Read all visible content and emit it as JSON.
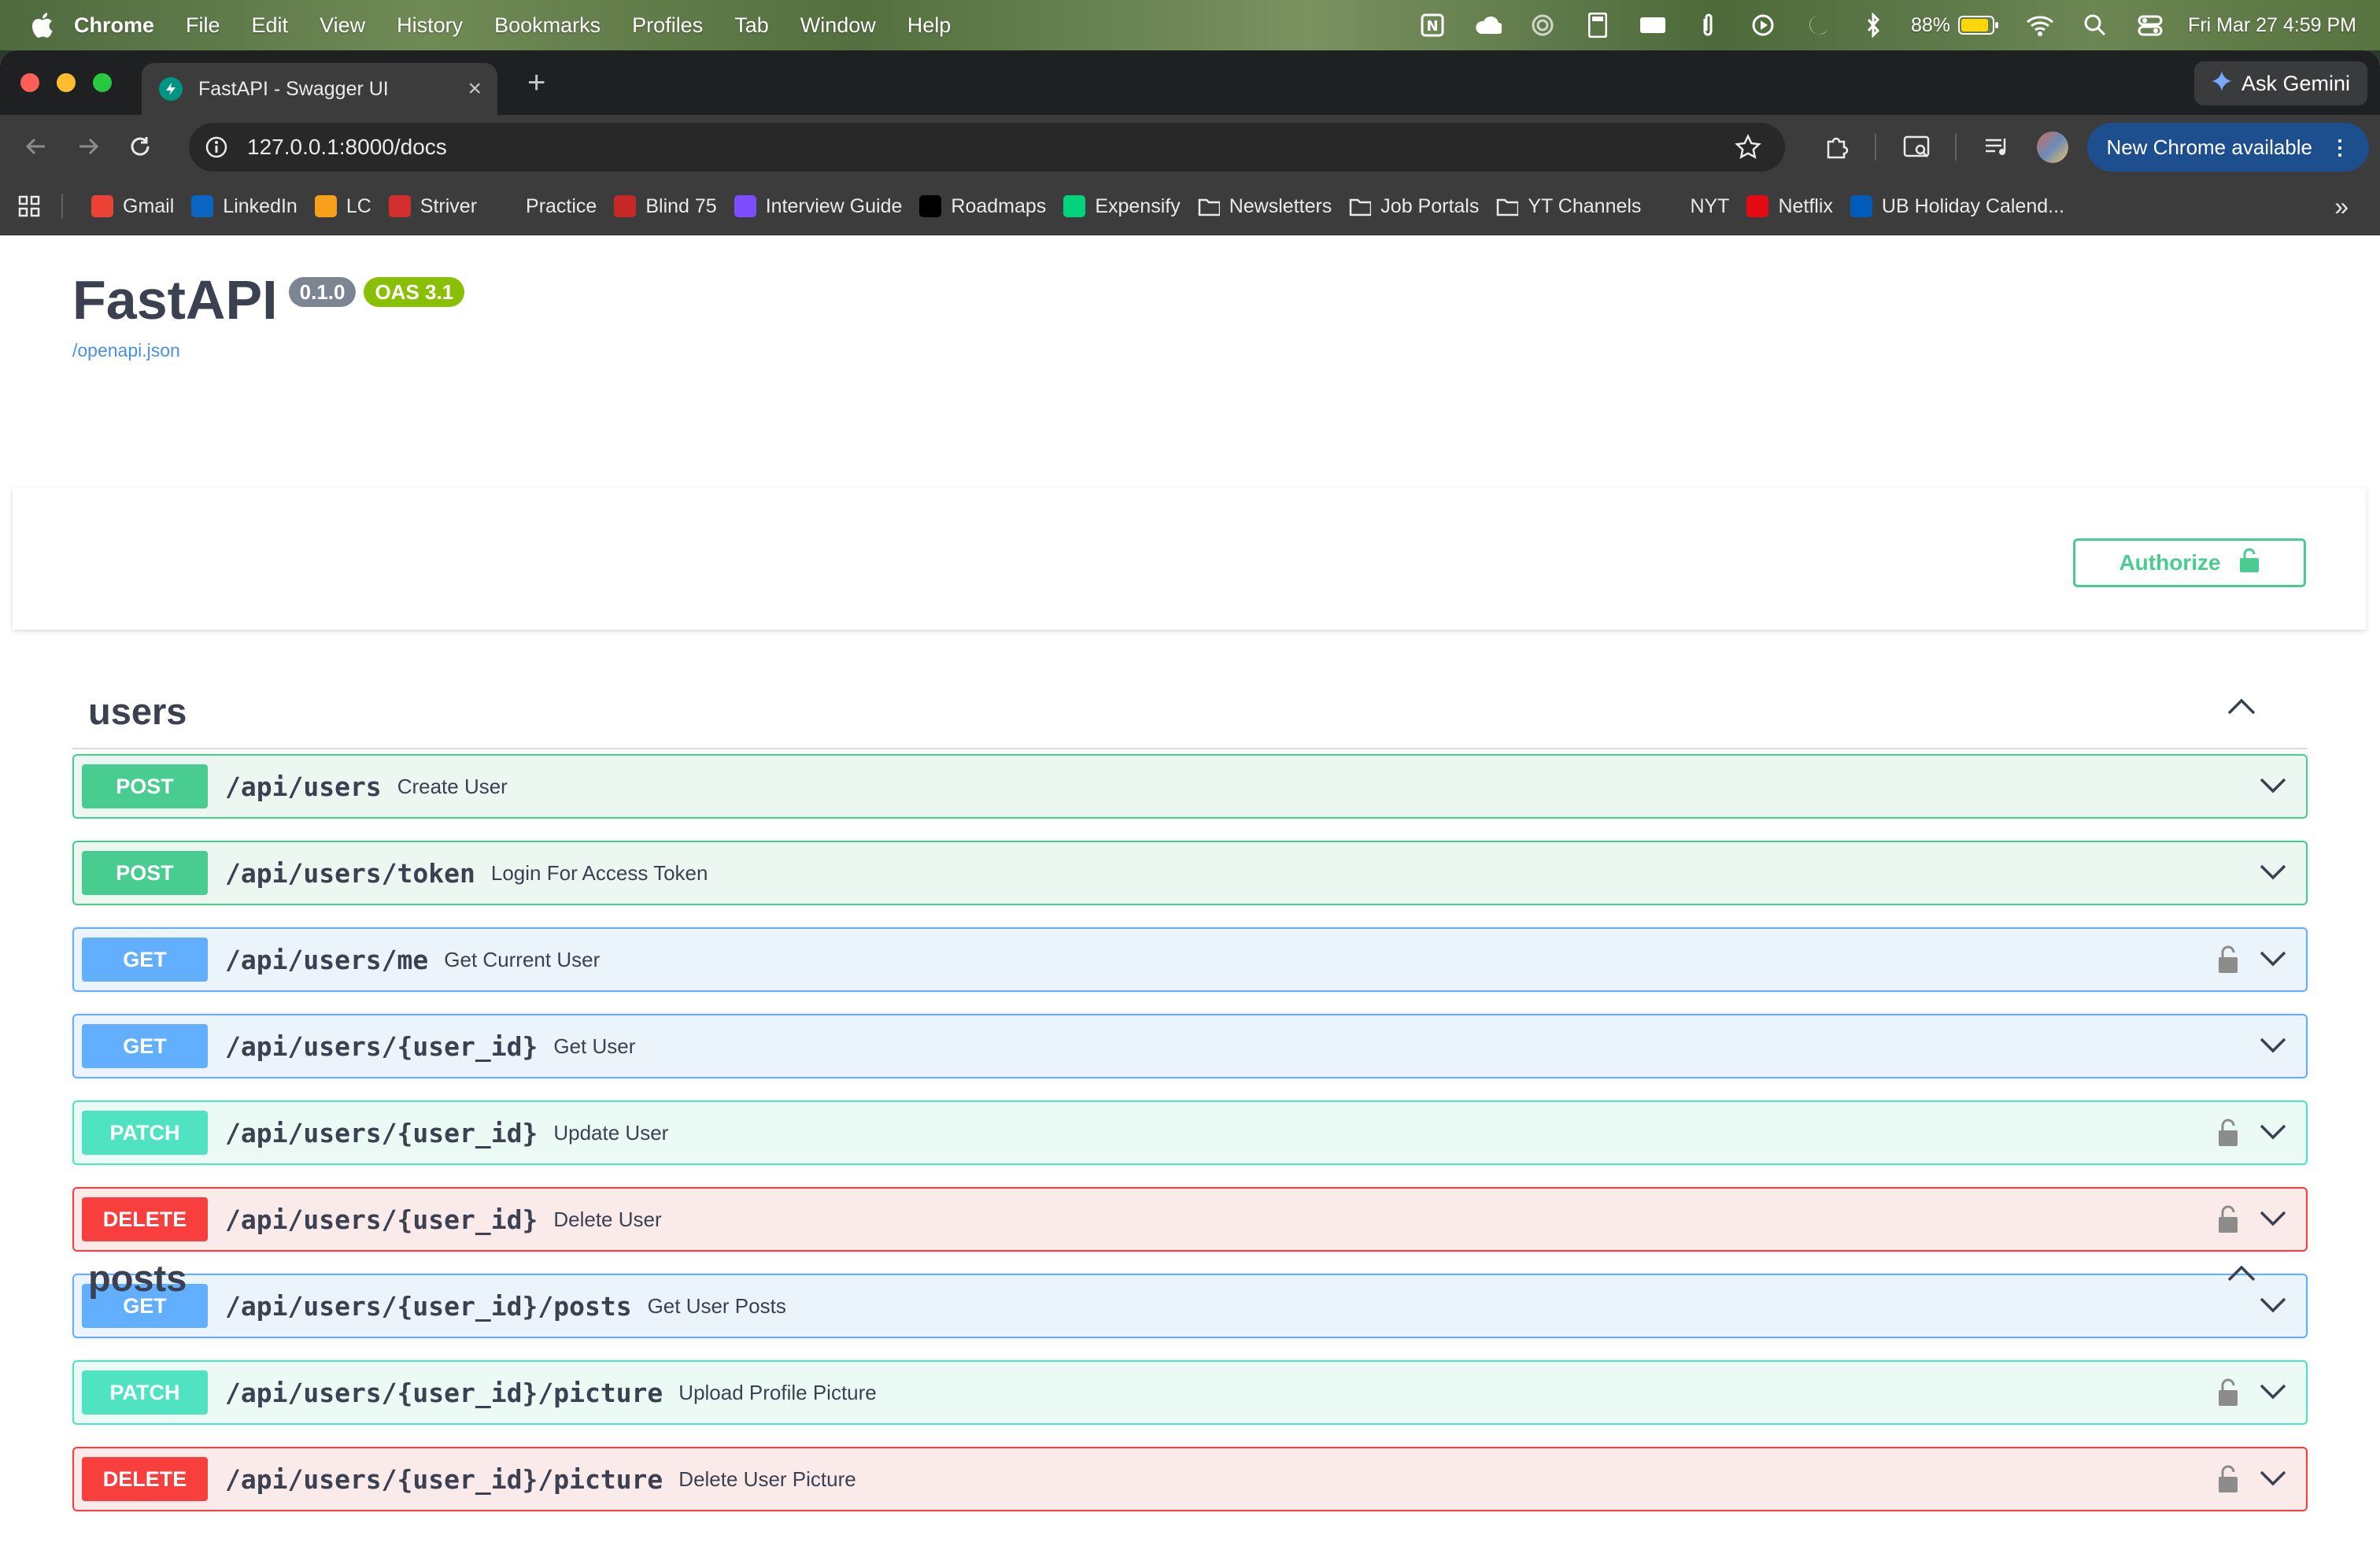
{
  "menubar": {
    "app_name": "Chrome",
    "items": [
      "File",
      "Edit",
      "View",
      "History",
      "Bookmarks",
      "Profiles",
      "Tab",
      "Window",
      "Help"
    ],
    "battery": "88%",
    "datetime": "Fri Mar 27  4:59 PM"
  },
  "browser": {
    "tab_title": "FastAPI - Swagger UI",
    "gemini_label": "Ask Gemini",
    "url": "127.0.0.1:8000/docs",
    "update_label": "New Chrome available",
    "bookmarks": [
      {
        "label": "Gmail",
        "icon": "gmail-icon",
        "color": "#ea4335"
      },
      {
        "label": "LinkedIn",
        "icon": "linkedin-icon",
        "color": "#0a66c2"
      },
      {
        "label": "LC",
        "icon": "leetcode-icon",
        "color": "#f89f1b"
      },
      {
        "label": "Striver",
        "icon": "striver-icon",
        "color": "#d32f2f"
      },
      {
        "label": "Practice",
        "icon": "rocket-icon",
        "color": "#3c3c3c"
      },
      {
        "label": "Blind 75",
        "icon": "blind-icon",
        "color": "#c62828"
      },
      {
        "label": "Interview Guide",
        "icon": "code-icon",
        "color": "#7c4dff"
      },
      {
        "label": "Roadmaps",
        "icon": "roadmaps-icon",
        "color": "#000000"
      },
      {
        "label": "Expensify",
        "icon": "expensify-icon",
        "color": "#03d47c"
      },
      {
        "label": "Newsletters",
        "icon": "folder-icon",
        "color": ""
      },
      {
        "label": "Job Portals",
        "icon": "folder-icon",
        "color": ""
      },
      {
        "label": "YT Channels",
        "icon": "folder-icon",
        "color": ""
      },
      {
        "label": "NYT",
        "icon": "nyt-icon",
        "color": "#3c3c3c"
      },
      {
        "label": "Netflix",
        "icon": "netflix-icon",
        "color": "#e50914"
      },
      {
        "label": "UB Holiday Calend...",
        "icon": "ub-icon",
        "color": "#005bbb"
      }
    ]
  },
  "swagger": {
    "title": "FastAPI",
    "version": "0.1.0",
    "oas": "OAS 3.1",
    "spec_link": "/openapi.json",
    "authorize_label": "Authorize",
    "tags": [
      {
        "name": "users",
        "operations": [
          {
            "method": "POST",
            "path": "/api/users",
            "summary": "Create User",
            "locked": false
          },
          {
            "method": "POST",
            "path": "/api/users/token",
            "summary": "Login For Access Token",
            "locked": false
          },
          {
            "method": "GET",
            "path": "/api/users/me",
            "summary": "Get Current User",
            "locked": true
          },
          {
            "method": "GET",
            "path": "/api/users/{user_id}",
            "summary": "Get User",
            "locked": false
          },
          {
            "method": "PATCH",
            "path": "/api/users/{user_id}",
            "summary": "Update User",
            "locked": true
          },
          {
            "method": "DELETE",
            "path": "/api/users/{user_id}",
            "summary": "Delete User",
            "locked": true
          },
          {
            "method": "GET",
            "path": "/api/users/{user_id}/posts",
            "summary": "Get User Posts",
            "locked": false
          },
          {
            "method": "PATCH",
            "path": "/api/users/{user_id}/picture",
            "summary": "Upload Profile Picture",
            "locked": true
          },
          {
            "method": "DELETE",
            "path": "/api/users/{user_id}/picture",
            "summary": "Delete User Picture",
            "locked": true
          }
        ]
      },
      {
        "name": "posts",
        "operations": []
      }
    ]
  },
  "colors": {
    "post": "#49cc90",
    "get": "#61affe",
    "patch": "#50e3c2",
    "delete": "#f93e3e"
  }
}
